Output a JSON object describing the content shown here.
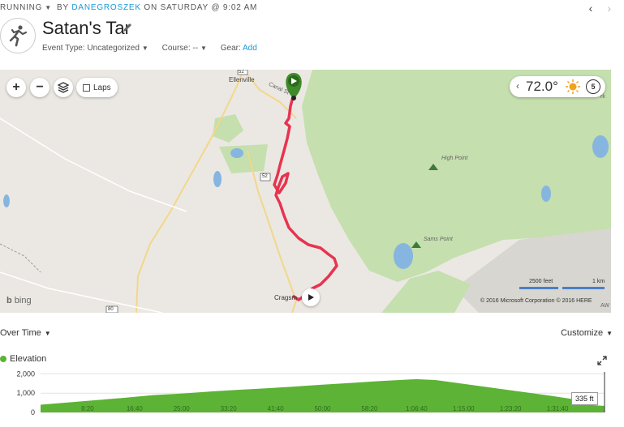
{
  "header": {
    "activity_type": "RUNNING",
    "by_prefix": "BY",
    "author": "DANEGROSZEK",
    "date_text": "ON SATURDAY @ 9:02 AM",
    "title": "Satan's Tar",
    "event_type_label": "Event Type: Uncategorized",
    "course_label": "Course: --",
    "gear_label": "Gear:",
    "gear_add": "Add",
    "nav_prev": "‹",
    "nav_next": "›"
  },
  "map": {
    "laps_label": "Laps",
    "temperature": "72.0°",
    "wind_value": "5",
    "labels": {
      "town": "Ellenville",
      "street": "Canal St",
      "high_point": "High Point",
      "sams_point": "Sams Point",
      "cragsmoor": "Cragsm",
      "route_52_top": "52",
      "route_52_mid": "52",
      "route_80": "80",
      "edge_k": "rk",
      "edge_aw": "AW"
    },
    "scale_feet": "2500 feet",
    "scale_km": "1 km",
    "copyright": "© 2016 Microsoft Corporation   © 2016 HERE",
    "bing": "bing",
    "colors": {
      "route": "#e8334f",
      "forest": "#c5dfae",
      "water": "#86b5e0",
      "start": "#3f8a2a"
    }
  },
  "chart_controls": {
    "over_time": "Over Time",
    "customize": "Customize",
    "legend": "Elevation",
    "tooltip": "335 ft"
  },
  "chart_data": {
    "type": "area",
    "series": [
      {
        "name": "Elevation",
        "color": "#5cb335",
        "x_seconds": [
          0,
          300,
          600,
          900,
          1200,
          1500,
          1800,
          2100,
          2400,
          2700,
          3000,
          3300,
          3600,
          3900,
          4000,
          4200,
          4500,
          4800,
          5100,
          5400,
          5700,
          5880,
          6000
        ],
        "values": [
          400,
          520,
          640,
          760,
          900,
          980,
          1080,
          1170,
          1250,
          1340,
          1440,
          1530,
          1620,
          1700,
          1720,
          1680,
          1480,
          1280,
          1080,
          880,
          660,
          380,
          335
        ]
      }
    ],
    "y_ticks": [
      "0",
      "1,000",
      "2,000"
    ],
    "y_values": [
      0,
      1000,
      2000
    ],
    "ylim": [
      0,
      2100
    ],
    "x_ticks": [
      "8:20",
      "16:40",
      "25:00",
      "33:20",
      "41:40",
      "50:00",
      "58:20",
      "1:06:40",
      "1:15:00",
      "1:23:20",
      "1:31:40"
    ],
    "x_tick_values": [
      500,
      1000,
      1500,
      2000,
      2500,
      3000,
      3500,
      4000,
      4500,
      5000,
      5500
    ],
    "xlim": [
      0,
      6000
    ],
    "grid": true
  }
}
